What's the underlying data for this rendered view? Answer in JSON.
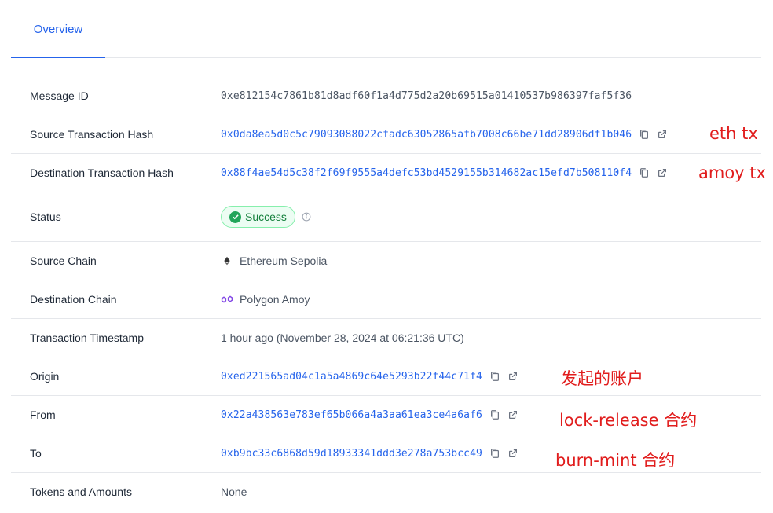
{
  "tabs": [
    {
      "label": "Overview"
    }
  ],
  "rows": {
    "message_id": {
      "label": "Message ID",
      "value": "0xe812154c7861b81d8adf60f1a4d775d2a20b69515a01410537b986397faf5f36"
    },
    "source_tx": {
      "label": "Source Transaction Hash",
      "value": "0x0da8ea5d0c5c79093088022cfadc63052865afb7008c66be71dd28906df1b046",
      "annotation": "eth tx"
    },
    "dest_tx": {
      "label": "Destination Transaction Hash",
      "value": "0x88f4ae54d5c38f2f69f9555a4defc53bd4529155b314682ac15efd7b508110f4",
      "annotation": "amoy tx"
    },
    "status": {
      "label": "Status",
      "value": "Success"
    },
    "source_chain": {
      "label": "Source Chain",
      "value": "Ethereum Sepolia"
    },
    "dest_chain": {
      "label": "Destination Chain",
      "value": "Polygon Amoy"
    },
    "timestamp": {
      "label": "Transaction Timestamp",
      "value": "1 hour ago (November 28, 2024 at 06:21:36 UTC)"
    },
    "origin": {
      "label": "Origin",
      "value": "0xed221565ad04c1a5a4869c64e5293b22f44c71f4",
      "annotation": "发起的账户"
    },
    "from": {
      "label": "From",
      "value": "0x22a438563e783ef65b066a4a3aa61ea3ce4a6af6",
      "annotation": "lock-release 合约"
    },
    "to": {
      "label": "To",
      "value": "0xb9bc33c6868d59d18933341ddd3e278a753bcc49",
      "annotation": "burn-mint 合约"
    },
    "tokens": {
      "label": "Tokens and Amounts",
      "value": "None"
    }
  },
  "colors": {
    "link": "#2563eb",
    "success": "#15803d",
    "annotation": "#e11d1d",
    "polygon": "#8247e5"
  }
}
